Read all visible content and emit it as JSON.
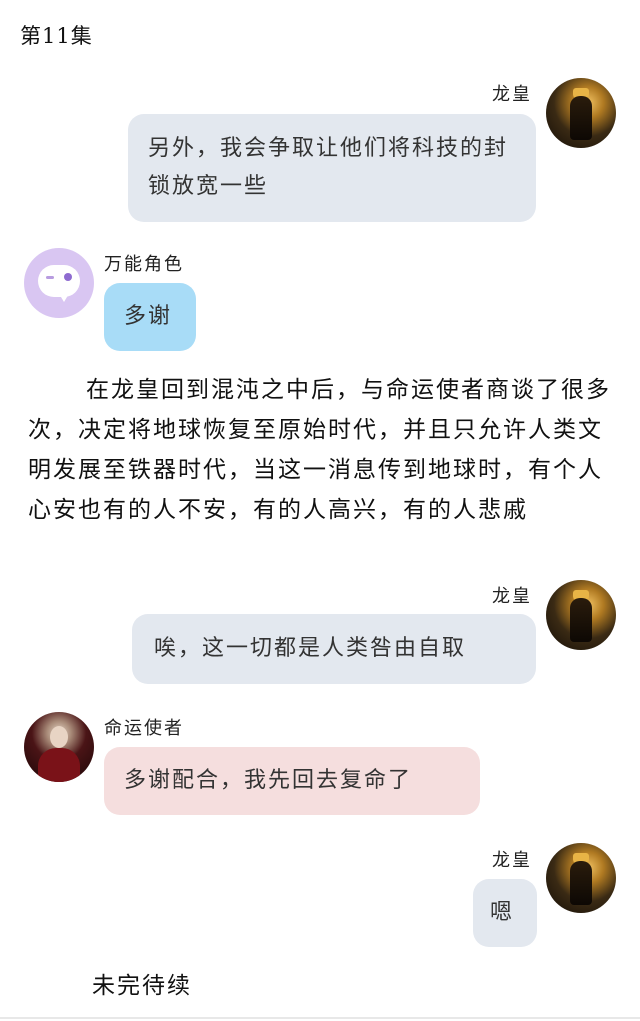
{
  "episode_title": "第11集",
  "messages": [
    {
      "speaker": "龙皇",
      "text": "另外，我会争取让他们将科技的封锁放宽一些"
    },
    {
      "speaker": "万能角色",
      "text": "多谢"
    },
    {
      "speaker": "龙皇",
      "text": "唉，这一切都是人类咎由自取"
    },
    {
      "speaker": "命运使者",
      "text": "多谢配合，我先回去复命了"
    },
    {
      "speaker": "龙皇",
      "text": "嗯"
    }
  ],
  "narration": "在龙皇回到混沌之中后，与命运使者商谈了很多次，决定将地球恢复至原始时代，并且只允许人类文明发展至铁器时代，当这一消息传到地球时，有个人心安也有的人不安，有的人高兴，有的人悲戚",
  "footer": "未完待续",
  "colors": {
    "bubble_right": "#e3e8ef",
    "bubble_blue": "#a8dcf7",
    "bubble_pink": "#f5dede"
  }
}
